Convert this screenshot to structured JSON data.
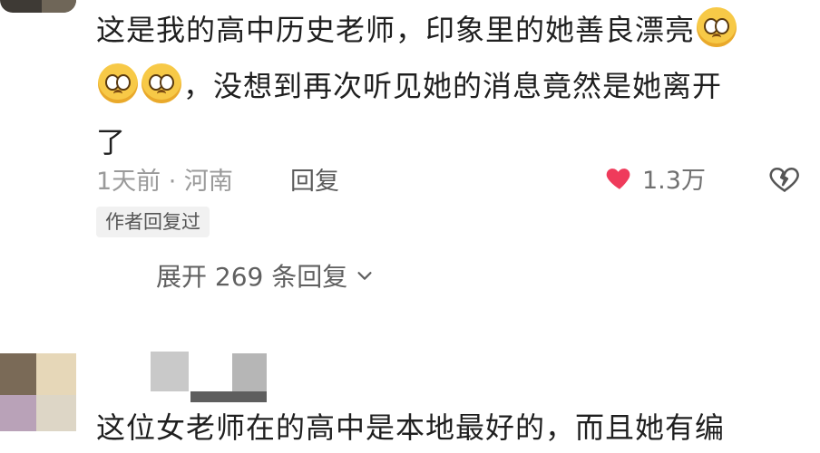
{
  "comment": {
    "text_line1": "这是我的高中历史老师，印象里的她善良漂亮",
    "text_line2": "，没想到再次听见她的消息竟然是她离开",
    "text_line3": "了",
    "emojis": [
      "crying-face",
      "crying-face",
      "crying-face"
    ],
    "time_location": "1天前 · 河南",
    "reply_label": "回复",
    "like_count": "1.3万",
    "author_replied_badge": "作者回复过",
    "expand_replies_label": "展开 269 条回复",
    "colors": {
      "heart": "#ef3b5b",
      "meta": "#9a9a9a"
    }
  },
  "next_comment": {
    "text": "这位女老师在的高中是本地最好的，而且她有编"
  }
}
